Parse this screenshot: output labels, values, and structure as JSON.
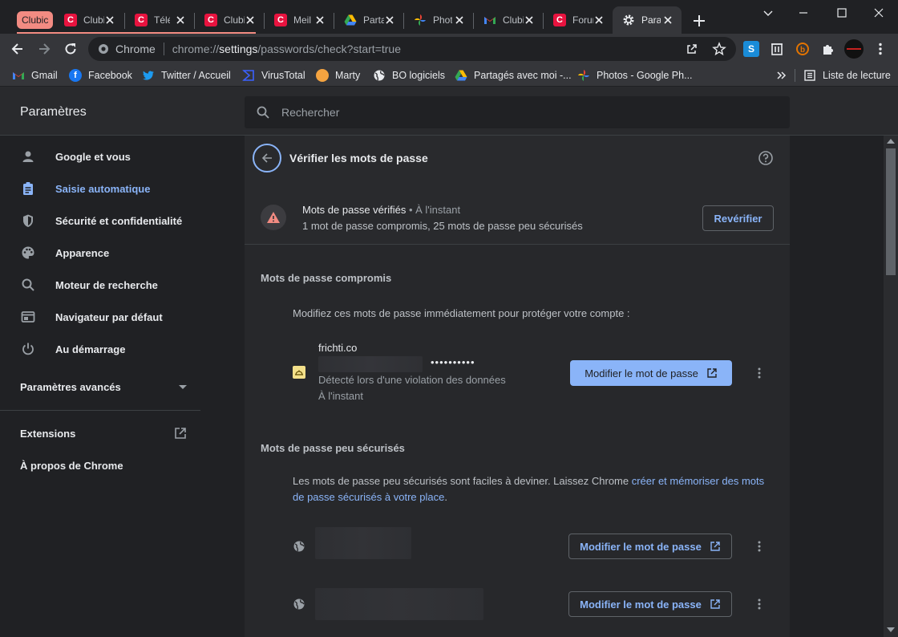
{
  "tabs": {
    "group_label": "Clubic",
    "items": [
      {
        "title": "Clubic",
        "favicon": "clubic-icon"
      },
      {
        "title": "Télécharger",
        "favicon": "clubic-icon"
      },
      {
        "title": "Clubic",
        "favicon": "clubic-icon"
      },
      {
        "title": "Meilleur",
        "favicon": "clubic-icon"
      },
      {
        "title": "Partagés",
        "favicon": "google-drive-icon"
      },
      {
        "title": "Photos",
        "favicon": "google-photos-icon"
      },
      {
        "title": "Clubic",
        "favicon": "gmail-icon"
      },
      {
        "title": "Forum",
        "favicon": "clubic-icon"
      }
    ],
    "active_title": "Paramètres"
  },
  "omnibox": {
    "site": "Chrome",
    "url_scheme": "chrome://",
    "url_host": "settings",
    "url_path": "/passwords/check?start=true"
  },
  "bookmarks": [
    {
      "label": "Gmail",
      "icon": "gmail-icon"
    },
    {
      "label": "Facebook",
      "icon": "facebook-icon"
    },
    {
      "label": "Twitter / Accueil",
      "icon": "twitter-icon"
    },
    {
      "label": "VirusTotal",
      "icon": "virustotal-icon"
    },
    {
      "label": "Marty",
      "icon": "marty-icon"
    },
    {
      "label": "BO logiciels",
      "icon": "globe-icon"
    },
    {
      "label": "Partagés avec moi -...",
      "icon": "google-drive-icon"
    },
    {
      "label": "Photos - Google Ph...",
      "icon": "google-photos-icon"
    }
  ],
  "reading_list": "Liste de lecture",
  "settings": {
    "title": "Paramètres",
    "search_placeholder": "Rechercher"
  },
  "sidebar": {
    "items": [
      {
        "label": "Google et vous",
        "icon": "person-icon"
      },
      {
        "label": "Saisie automatique",
        "icon": "clipboard-icon",
        "active": true
      },
      {
        "label": "Sécurité et confidentialité",
        "icon": "shield-icon"
      },
      {
        "label": "Apparence",
        "icon": "palette-icon"
      },
      {
        "label": "Moteur de recherche",
        "icon": "search-icon"
      },
      {
        "label": "Navigateur par défaut",
        "icon": "browser-icon"
      },
      {
        "label": "Au démarrage",
        "icon": "power-icon"
      }
    ],
    "advanced": "Paramètres avancés",
    "extensions": "Extensions",
    "about": "À propos de Chrome"
  },
  "page": {
    "heading": "Vérifier les mots de passe",
    "status_title": "Mots de passe vérifiés",
    "status_time": " • À l'instant",
    "status_summary": "1 mot de passe compromis, 25 mots de passe peu sécurisés",
    "recheck_label": "Revérifier",
    "compromised": {
      "title": "Mots de passe compromis",
      "description": "Modifiez ces mots de passe immédiatement pour protéger votre compte :",
      "item": {
        "site": "frichti.co",
        "password": "••••••••••",
        "reason": "Détecté lors d'une violation des données",
        "time": "À l'instant",
        "button": "Modifier le mot de passe"
      }
    },
    "weak": {
      "title": "Mots de passe peu sécurisés",
      "description_prefix": "Les mots de passe peu sécurisés sont faciles à deviner. Laissez Chrome ",
      "description_link": "créer et mémoriser des mots de passe sécurisés à votre place",
      "description_suffix": ".",
      "button": "Modifier le mot de passe"
    }
  },
  "colors": {
    "accent": "#8ab4f8",
    "tab_group": "#f28b82",
    "clubic": "#e8133f",
    "warning": "#f28b82"
  }
}
